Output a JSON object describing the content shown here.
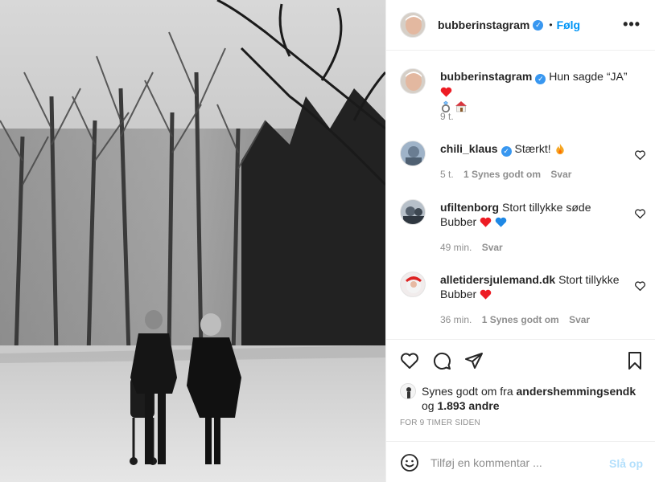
{
  "post": {
    "author": "bubberinstagram",
    "follow_label": "Følg",
    "separator": "•",
    "more_glyph": "•••",
    "verified_glyph": "✓",
    "caption": {
      "username": "bubberinstagram",
      "text": "Hun sagde “JA”",
      "time": "9 t."
    }
  },
  "comments": [
    {
      "username": "chili_klaus",
      "verified": true,
      "text": "Stærkt!",
      "time": "5 t.",
      "likes": "1 Synes godt om",
      "reply": "Svar"
    },
    {
      "username": "ufiltenborg",
      "verified": false,
      "text": "Stort tillykke søde Bubber",
      "time": "49 min.",
      "likes": "",
      "reply": "Svar"
    },
    {
      "username": "alletidersjulemand.dk",
      "verified": false,
      "text": "Stort tillykke Bubber",
      "time": "36 min.",
      "likes": "1 Synes godt om",
      "reply": "Svar"
    }
  ],
  "likes": {
    "prefix": "Synes godt om fra",
    "user": "andershemmingsendk",
    "and": "og",
    "count": "1.893 andre"
  },
  "timestamp": "FOR 9 TIMER SIDEN",
  "add_comment": {
    "placeholder": "Tilføj en kommentar ...",
    "post_label": "Slå op"
  },
  "icons": {
    "more": "more-options-icon",
    "like": "heart-icon",
    "comment": "comment-bubble-icon",
    "share": "paper-plane-icon",
    "save": "bookmark-icon",
    "emoji": "smiley-icon"
  },
  "colors": {
    "accent": "#0095f6",
    "verified": "#3897f0",
    "muted": "#8e8e8e",
    "disabled_post": "#b2dffc",
    "heart_red": "#ed1c24",
    "heart_blue": "#1e88e5"
  }
}
